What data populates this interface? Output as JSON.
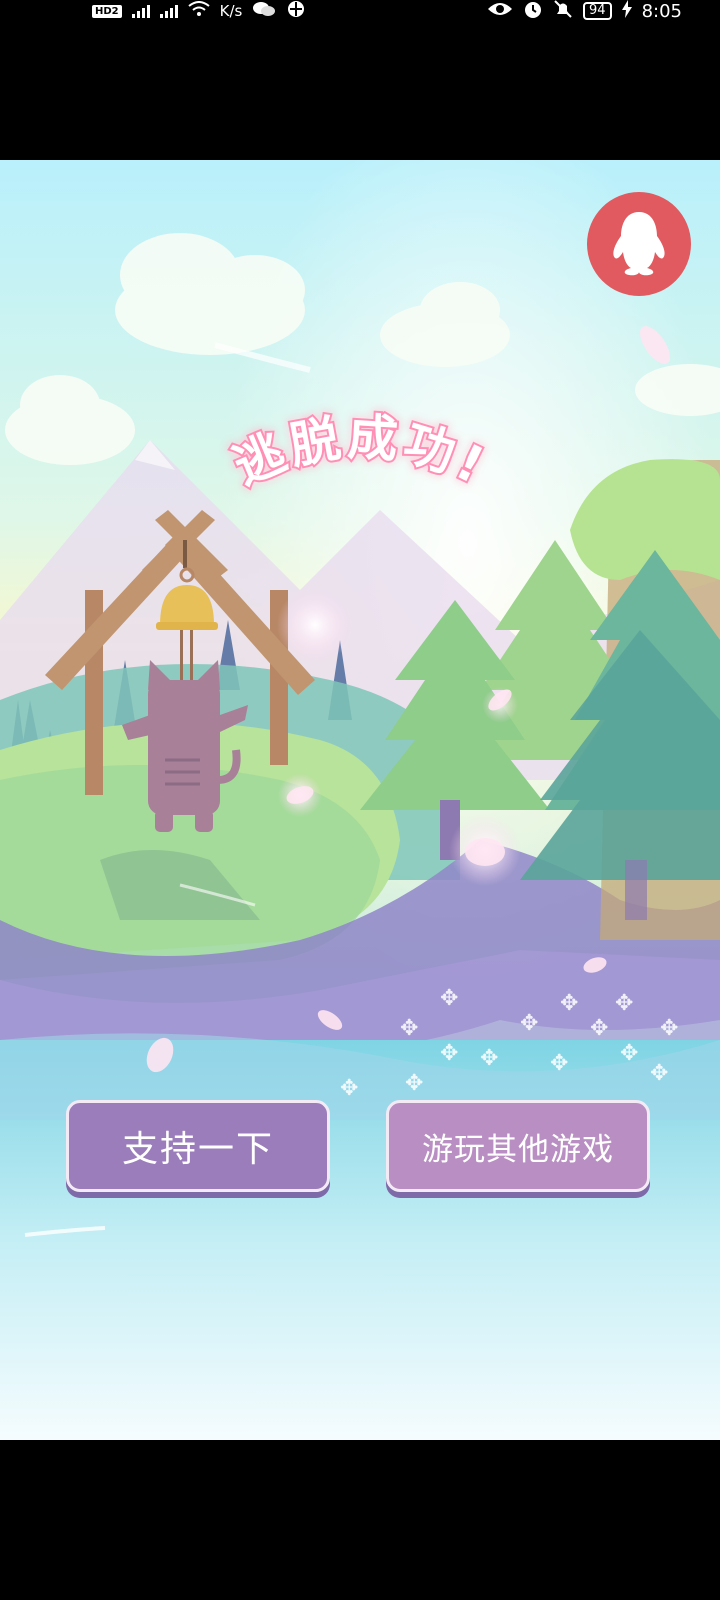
{
  "status_bar": {
    "hd_label": "HD",
    "sim_label": "2",
    "speed_unit": "K/s",
    "battery": "94",
    "time": "8:05"
  },
  "game": {
    "title": "逃脱成功!",
    "support_button_label": "支持一下",
    "other_games_button_label": "游玩其他游戏",
    "qq_button_icon": "qq-penguin-icon"
  },
  "colors": {
    "qq_button": "#e05a5f",
    "support_button": "#9a7dba",
    "other_games_button": "#b98ec2",
    "title_pink": "#ff8fb5"
  }
}
